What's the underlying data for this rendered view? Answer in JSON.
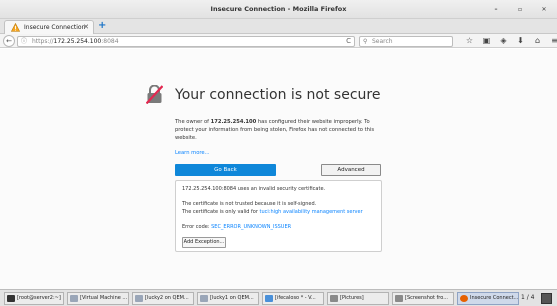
{
  "window": {
    "title": "Insecure Connection - Mozilla Firefox",
    "controls": [
      "–",
      "▫",
      "✕"
    ]
  },
  "tab": {
    "label": "Insecure Connection",
    "close": "✕",
    "new_tab": "+"
  },
  "navbar": {
    "back": "←",
    "url_scheme": "https://",
    "url_host": "172.25.254.100",
    "url_port": ":8084",
    "reload": "C",
    "search_placeholder": "Search",
    "icons": [
      "bookmark-star-icon",
      "clipboard-icon",
      "shield-icon",
      "download-icon",
      "home-icon",
      "menu-icon"
    ]
  },
  "error_page": {
    "title": "Your connection is not secure",
    "desc_prefix": "The owner of ",
    "desc_host": "172.25.254.100",
    "desc_suffix": " has configured their website improperly. To protect your information from being stolen, Firefox has not connected to this website.",
    "learn_more": "Learn more...",
    "go_back": "Go Back",
    "advanced": "Advanced",
    "adv_line1": "172.25.254.100:8084 uses an invalid security certificate.",
    "adv_line2": "The certificate is not trusted because it is self-signed.",
    "adv_line3_prefix": "The certificate is only valid for ",
    "adv_line3_link": "tuci:high availability management server",
    "adv_error_label": "Error code: ",
    "adv_error_code": "SEC_ERROR_UNKNOWN_ISSUER",
    "add_exception": "Add Exception..."
  },
  "taskbar": {
    "items": [
      {
        "label": "[root@server2:~]"
      },
      {
        "label": "[Virtual Machine ..."
      },
      {
        "label": "[lucky2 on QEM..."
      },
      {
        "label": "[lucky1 on QEM..."
      },
      {
        "label": "[ifecaloso * - V..."
      },
      {
        "label": "[Pictures]"
      },
      {
        "label": "[Screenshot fro..."
      },
      {
        "label": "Insecure Connect..."
      }
    ],
    "pager": "1 / 4"
  }
}
